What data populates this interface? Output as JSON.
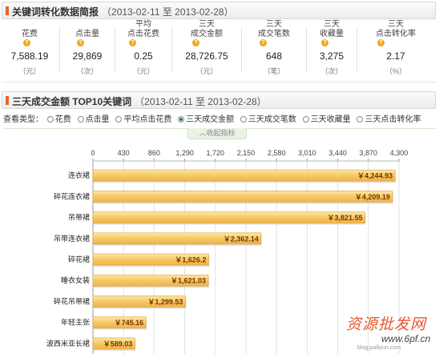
{
  "summary": {
    "title": "关键词转化数据简报",
    "date_range": "（2013-02-11 至 2013-02-28）",
    "stats": [
      {
        "label_lines": [
          "花费"
        ],
        "value": "7,588.19",
        "unit": "（元）",
        "has_help": true
      },
      {
        "label_lines": [
          "点击量"
        ],
        "value": "29,869",
        "unit": "（次）",
        "has_help": true
      },
      {
        "label_lines": [
          "平均",
          "点击花费"
        ],
        "value": "0.25",
        "unit": "（元）",
        "has_help": true
      },
      {
        "label_lines": [
          "三天",
          "成交金额"
        ],
        "value": "28,726.75",
        "unit": "（元）",
        "has_help": true
      },
      {
        "label_lines": [
          "三天",
          "成交笔数"
        ],
        "value": "648",
        "unit": "（笔）",
        "has_help": true
      },
      {
        "label_lines": [
          "三天",
          "收藏量"
        ],
        "value": "3,275",
        "unit": "（次）",
        "has_help": true
      },
      {
        "label_lines": [
          "三天",
          "点击转化率"
        ],
        "value": "2.17",
        "unit": "（%）",
        "has_help": true
      }
    ]
  },
  "ranking": {
    "title": "三天成交金额 TOP10关键词",
    "date_range": "（2013-02-11 至 2013-02-28）"
  },
  "filters": {
    "label": "查看类型：",
    "options": [
      "花费",
      "点击量",
      "平均点击花费",
      "三天成交金额",
      "三天成交笔数",
      "三天收藏量",
      "三天点击转化率"
    ],
    "selected": "三天成交金额"
  },
  "collapse_label": "收起指标",
  "colors": {
    "bar": "#f3c565",
    "bar_edge": "#e0a030",
    "accent": "#e8622a",
    "value_text": "#7a3300"
  },
  "chart_data": {
    "type": "bar",
    "orientation": "horizontal",
    "categories": [
      "连衣裙",
      "碎花连衣裙",
      "吊带裙",
      "吊带连衣裙",
      "碎花裙",
      "睡衣女装",
      "碎花吊带裙",
      "年轻主张",
      "波西米亚长裙"
    ],
    "values": [
      4244.93,
      4209.19,
      3821.55,
      2362.14,
      1626.2,
      1621.03,
      1299.53,
      745.16,
      589.03
    ],
    "value_labels": [
      "￥4,244.93",
      "￥4,209.19",
      "￥3,821.55",
      "￥2,362.14",
      "￥1,626.2",
      "￥1,621.03",
      "￥1,299.53",
      "￥745.16",
      "￥589.03"
    ],
    "x_ticks": [
      "0",
      "430",
      "860",
      "1,290",
      "1,720",
      "2,150",
      "2,580",
      "3,010",
      "3,440",
      "3,870",
      "4,300"
    ],
    "xlim": [
      0,
      4300
    ],
    "grid": true
  },
  "watermark": {
    "main": "资源批发网",
    "url": "www.6pf.cn",
    "small": "blog.pailiyun.com"
  }
}
